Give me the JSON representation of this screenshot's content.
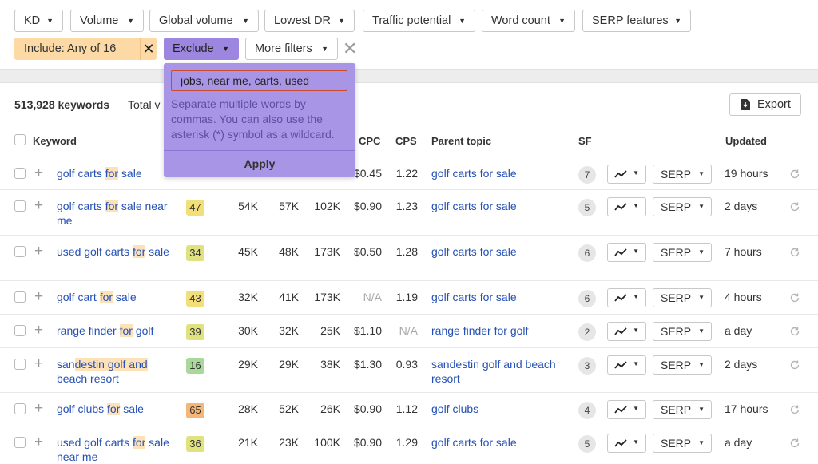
{
  "filters": {
    "buttons": [
      {
        "label": "KD"
      },
      {
        "label": "Volume"
      },
      {
        "label": "Global volume"
      },
      {
        "label": "Lowest DR"
      },
      {
        "label": "Traffic potential"
      },
      {
        "label": "Word count"
      },
      {
        "label": "SERP features"
      }
    ],
    "include_chip": "Include: Any of 16",
    "exclude_label": "Exclude",
    "more_filters_label": "More filters"
  },
  "exclude_popover": {
    "input_value": "jobs, near me, carts, used",
    "help_text": "Separate multiple words by commas. You can also use the asterisk (*) symbol as a wildcard.",
    "apply_label": "Apply"
  },
  "results": {
    "count": "513,928 keywords",
    "total_label": "Total v",
    "export_label": "Export"
  },
  "table": {
    "headers": {
      "keyword": "Keyword",
      "cpc": "CPC",
      "cps": "CPS",
      "parent_topic": "Parent topic",
      "sf": "SF",
      "updated": "Updated"
    },
    "trend_icon": "trend-chart-icon",
    "serp_label": "SERP",
    "rows": [
      {
        "keyword": [
          {
            "t": "golf carts "
          },
          {
            "t": "for",
            "hl": true
          },
          {
            "t": " sale"
          }
        ],
        "kd": "",
        "kd_color": "#f2df7a",
        "volume": "",
        "global": "",
        "traffic": "",
        "cpc": "$0.45",
        "cps": "1.22",
        "parent": "golf carts for sale",
        "sf": "7",
        "updated": "19 hours"
      },
      {
        "keyword": [
          {
            "t": "golf carts "
          },
          {
            "t": "for",
            "hl": true
          },
          {
            "t": " sale near me"
          }
        ],
        "kd": "47",
        "kd_color": "#f2df7a",
        "volume": "54K",
        "global": "57K",
        "traffic": "102K",
        "cpc": "$0.90",
        "cps": "1.23",
        "parent": "golf carts for sale",
        "sf": "5",
        "updated": "2 days"
      },
      {
        "keyword": [
          {
            "t": "used golf carts "
          },
          {
            "t": "for",
            "hl": true
          },
          {
            "t": " sale"
          }
        ],
        "kd": "34",
        "kd_color": "#e0e17f",
        "volume": "45K",
        "global": "48K",
        "traffic": "173K",
        "cpc": "$0.50",
        "cps": "1.28",
        "parent": "golf carts for sale",
        "sf": "6",
        "updated": "7 hours"
      },
      {
        "keyword": [
          {
            "t": "golf cart "
          },
          {
            "t": "for",
            "hl": true
          },
          {
            "t": " sale"
          }
        ],
        "kd": "43",
        "kd_color": "#f2df7a",
        "volume": "32K",
        "global": "41K",
        "traffic": "173K",
        "cpc": "N/A",
        "cps": "1.19",
        "parent": "golf carts for sale",
        "sf": "6",
        "updated": "4 hours"
      },
      {
        "keyword": [
          {
            "t": "range finder "
          },
          {
            "t": "for",
            "hl": true
          },
          {
            "t": " golf"
          }
        ],
        "kd": "39",
        "kd_color": "#e0e17f",
        "volume": "30K",
        "global": "32K",
        "traffic": "25K",
        "cpc": "$1.10",
        "cps": "N/A",
        "parent": "range finder for golf",
        "sf": "2",
        "updated": "a day"
      },
      {
        "keyword": [
          {
            "t": "san"
          },
          {
            "t": "destin golf ",
            "hl": true
          },
          {
            "t": "and",
            "hl": true
          },
          {
            "t": " beach resort"
          }
        ],
        "kd": "16",
        "kd_color": "#a8d99b",
        "volume": "29K",
        "global": "29K",
        "traffic": "38K",
        "cpc": "$1.30",
        "cps": "0.93",
        "parent": "sandestin golf and beach resort",
        "sf": "3",
        "updated": "2 days"
      },
      {
        "keyword": [
          {
            "t": "golf clubs "
          },
          {
            "t": "for",
            "hl": true
          },
          {
            "t": " sale"
          }
        ],
        "kd": "65",
        "kd_color": "#f5b777",
        "volume": "28K",
        "global": "52K",
        "traffic": "26K",
        "cpc": "$0.90",
        "cps": "1.12",
        "parent": "golf clubs",
        "sf": "4",
        "updated": "17 hours"
      },
      {
        "keyword": [
          {
            "t": "used golf carts "
          },
          {
            "t": "for",
            "hl": true
          },
          {
            "t": " sale near me"
          }
        ],
        "kd": "36",
        "kd_color": "#e0e17f",
        "volume": "21K",
        "global": "23K",
        "traffic": "100K",
        "cpc": "$0.90",
        "cps": "1.29",
        "parent": "golf carts for sale",
        "sf": "5",
        "updated": "a day"
      }
    ]
  }
}
